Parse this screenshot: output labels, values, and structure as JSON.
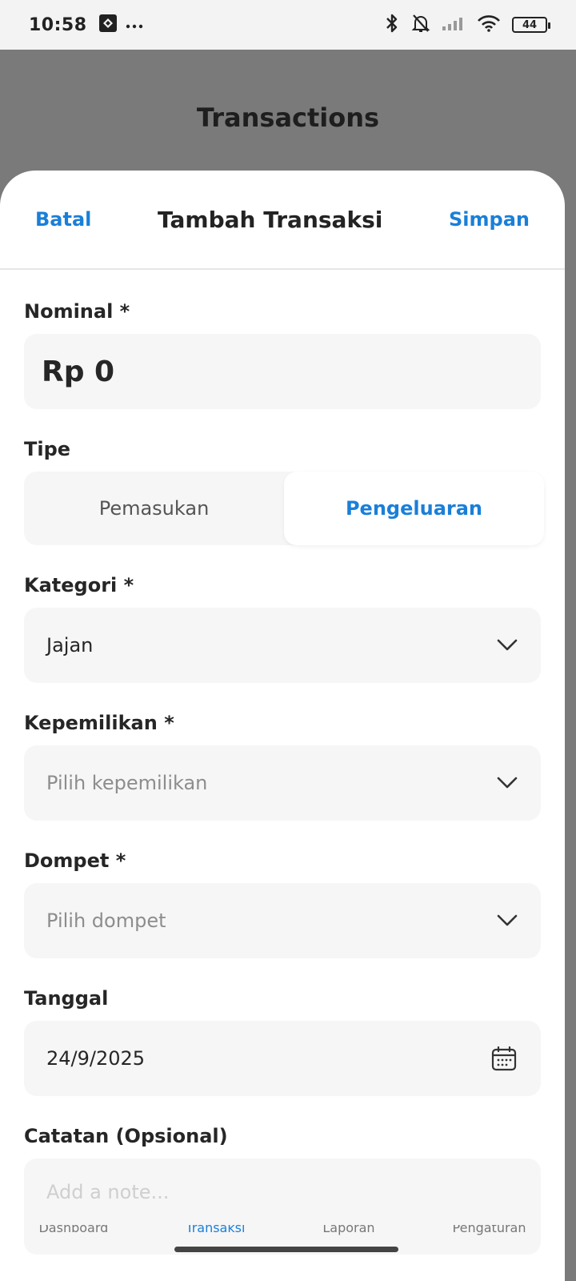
{
  "status_bar": {
    "time": "10:58",
    "battery": "44",
    "icons": [
      "app-notification-icon",
      "more-dots-icon",
      "bluetooth-icon",
      "mute-icon",
      "signal-icon",
      "wifi-icon",
      "battery-icon"
    ]
  },
  "page": {
    "title": "Transactions"
  },
  "sheet": {
    "cancel_label": "Batal",
    "title": "Tambah Transaksi",
    "save_label": "Simpan"
  },
  "form": {
    "nominal": {
      "label": "Nominal *",
      "value": "Rp 0"
    },
    "type": {
      "label": "Tipe",
      "options": [
        "Pemasukan",
        "Pengeluaran"
      ],
      "selected": "Pengeluaran"
    },
    "category": {
      "label": "Kategori *",
      "value": "Jajan"
    },
    "ownership": {
      "label": "Kepemilikan *",
      "placeholder": "Pilih kepemilikan"
    },
    "wallet": {
      "label": "Dompet *",
      "placeholder": "Pilih dompet"
    },
    "date": {
      "label": "Tanggal",
      "value": "24/9/2025"
    },
    "note": {
      "label": "Catatan (Opsional)",
      "placeholder": "Add a note..."
    }
  },
  "bottom_nav": {
    "items": [
      "Dashboard",
      "Transaksi",
      "Laporan",
      "Pengaturan"
    ],
    "active": "Transaksi"
  },
  "colors": {
    "accent": "#1a7fd8",
    "backdrop": "#7a7a7a",
    "field_bg": "#f6f6f6"
  }
}
